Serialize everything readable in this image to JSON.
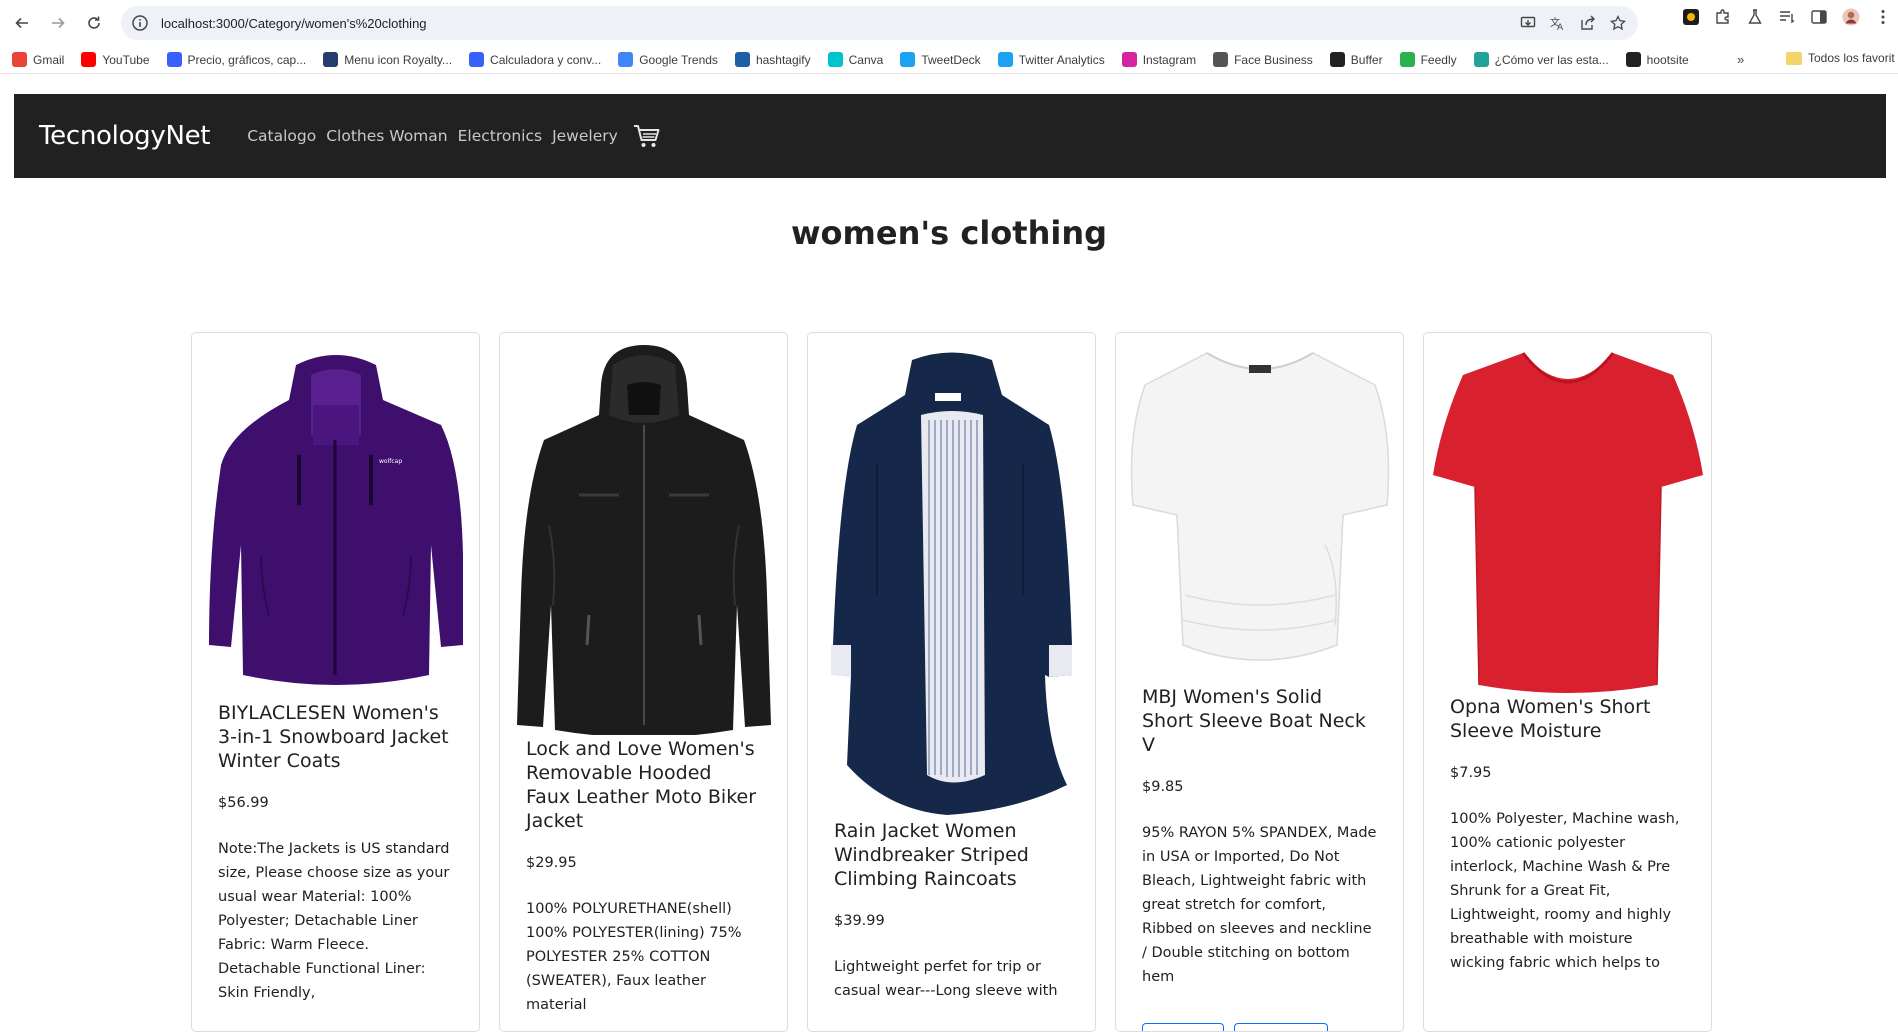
{
  "browser": {
    "url": "localhost:3000/Category/women's%20clothing",
    "bookmarks": [
      {
        "label": "Gmail",
        "icon": "gmail-icon",
        "color": "#ea4335"
      },
      {
        "label": "YouTube",
        "icon": "youtube-icon",
        "color": "#ff0000"
      },
      {
        "label": "Precio, gráficos, cap...",
        "icon": "coinmarketcap-icon",
        "color": "#3861fb"
      },
      {
        "label": "Menu icon Royalty...",
        "icon": "vectorstock-icon",
        "color": "#233e6e"
      },
      {
        "label": "Calculadora y conv...",
        "icon": "calculator-icon",
        "color": "#3861fb"
      },
      {
        "label": "Google Trends",
        "icon": "trends-icon",
        "color": "#4285f4"
      },
      {
        "label": "hashtagify",
        "icon": "hashtagify-icon",
        "color": "#1e5fa8"
      },
      {
        "label": "Canva",
        "icon": "canva-icon",
        "color": "#00c4cc"
      },
      {
        "label": "TweetDeck",
        "icon": "tweetdeck-icon",
        "color": "#1da1f2"
      },
      {
        "label": "Twitter Analytics",
        "icon": "twitter-icon",
        "color": "#1da1f2"
      },
      {
        "label": "Instagram",
        "icon": "instagram-icon",
        "color": "#d6249f"
      },
      {
        "label": "Face Business",
        "icon": "facebook-business-icon",
        "color": "#555555"
      },
      {
        "label": "Buffer",
        "icon": "buffer-icon",
        "color": "#222222"
      },
      {
        "label": "Feedly",
        "icon": "feedly-icon",
        "color": "#2bb24c"
      },
      {
        "label": "¿Cómo ver las esta...",
        "icon": "hootsuite-help-icon",
        "color": "#1fa39a"
      },
      {
        "label": "hootsite",
        "icon": "hootsuite-icon",
        "color": "#222222"
      }
    ],
    "more_label": "»",
    "all_bookmarks_label": "Todos los favorit"
  },
  "site": {
    "brand": "TecnologyNet",
    "nav": [
      "Catalogo",
      "Clothes Woman",
      "Electronics",
      "Jewelery"
    ],
    "cart_icon": "cart-icon",
    "colors": {
      "navbar": "#212121",
      "button_outline": "#0d6efd"
    }
  },
  "category_title": "women's clothing",
  "products": [
    {
      "title": "BIYLACLESEN Women's 3-in-1 Snowboard Jacket Winter Coats",
      "price": "$56.99",
      "description": "Note:The Jackets is US standard size, Please choose size as your usual wear Material: 100% Polyester; Detachable Liner Fabric: Warm Fleece. Detachable Functional Liner: Skin Friendly,",
      "image": "purple-jacket-image"
    },
    {
      "title": "Lock and Love Women's Removable Hooded Faux Leather Moto Biker Jacket",
      "price": "$29.95",
      "description": "100% POLYURETHANE(shell) 100% POLYESTER(lining) 75% POLYESTER 25% COTTON (SWEATER), Faux leather material",
      "image": "black-leather-jacket-image"
    },
    {
      "title": "Rain Jacket Women Windbreaker Striped Climbing Raincoats",
      "price": "$39.99",
      "description": "Lightweight perfet for trip or casual wear---Long sleeve with",
      "image": "navy-raincoat-image"
    },
    {
      "title": "MBJ Women's Solid Short Sleeve Boat Neck V",
      "price": "$9.85",
      "description": "95% RAYON 5% SPANDEX, Made in USA or Imported, Do Not Bleach, Lightweight fabric with great stretch for comfort, Ribbed on sleeves and neckline / Double stitching on bottom hem",
      "image": "white-top-image"
    },
    {
      "title": "Opna Women's Short Sleeve Moisture",
      "price": "$7.95",
      "description": "100% Polyester, Machine wash, 100% cationic polyester interlock, Machine Wash & Pre Shrunk for a Great Fit, Lightweight, roomy and highly breathable with moisture wicking fabric which helps to",
      "image": "red-tshirt-image"
    }
  ]
}
